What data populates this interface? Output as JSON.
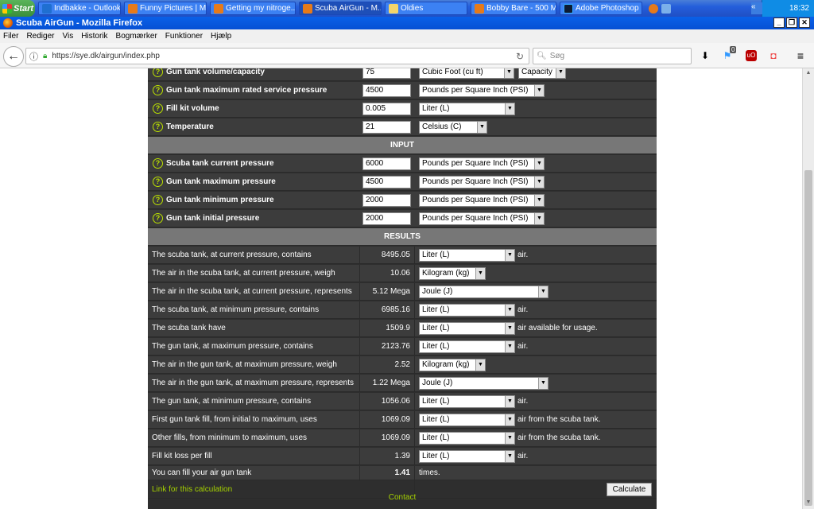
{
  "taskbar": {
    "start_label": "Start",
    "items": [
      {
        "label": "Indbakke - Outlook ..."
      },
      {
        "label": "Funny Pictures | M..."
      },
      {
        "label": "Getting my nitroge..."
      },
      {
        "label": "Scuba AirGun - M..."
      },
      {
        "label": "Oldies"
      },
      {
        "label": "Bobby Bare - 500 M..."
      },
      {
        "label": "Adobe Photoshop"
      }
    ],
    "tray_toggle": "«",
    "clock": "18:32"
  },
  "window": {
    "title": "Scuba AirGun - Mozilla Firefox"
  },
  "menu": [
    "Filer",
    "Rediger",
    "Vis",
    "Historik",
    "Bogmærker",
    "Funktioner",
    "Hjælp"
  ],
  "browser": {
    "url": "https://sye.dk/airgun/index.php",
    "search_placeholder": "Søg",
    "notification_count": "0"
  },
  "settings_rows": [
    {
      "label": "Gun tank volume/capacity",
      "value": "75",
      "unit": "Cubic Foot (cu ft)",
      "unit2": "Capacity"
    },
    {
      "label": "Gun tank maximum rated service pressure",
      "value": "4500",
      "unit": "Pounds per Square Inch (PSI)"
    },
    {
      "label": "Fill kit volume",
      "value": "0.005",
      "unit": "Liter (L)"
    },
    {
      "label": "Temperature",
      "value": "21",
      "unit": "Celsius (C)"
    }
  ],
  "input_header": "INPUT",
  "input_rows": [
    {
      "label": "Scuba tank current pressure",
      "value": "6000",
      "unit": "Pounds per Square Inch (PSI)"
    },
    {
      "label": "Gun tank maximum pressure",
      "value": "4500",
      "unit": "Pounds per Square Inch (PSI)"
    },
    {
      "label": "Gun tank minimum pressure",
      "value": "2000",
      "unit": "Pounds per Square Inch (PSI)"
    },
    {
      "label": "Gun tank initial pressure",
      "value": "2000",
      "unit": "Pounds per Square Inch (PSI)"
    }
  ],
  "results_header": "RESULTS",
  "result_rows": [
    {
      "label": "The scuba tank, at current pressure, contains",
      "value": "8495.05",
      "unit": "Liter (L)",
      "suffix": "air."
    },
    {
      "label": "The air in the scuba tank, at current pressure, weigh",
      "value": "10.06",
      "unit": "Kilogram (kg)",
      "suffix": ""
    },
    {
      "label": "The air in the scuba tank, at current pressure, represents",
      "value": "5.12 Mega",
      "unit": "Joule (J)",
      "suffix": ""
    },
    {
      "label": "The scuba tank, at minimum pressure, contains",
      "value": "6985.16",
      "unit": "Liter (L)",
      "suffix": "air."
    },
    {
      "label": "The scuba tank have",
      "value": "1509.9",
      "unit": "Liter (L)",
      "suffix": "air available for usage."
    },
    {
      "label": "The gun tank, at maximum pressure, contains",
      "value": "2123.76",
      "unit": "Liter (L)",
      "suffix": "air."
    },
    {
      "label": "The air in the gun tank, at maximum pressure, weigh",
      "value": "2.52",
      "unit": "Kilogram (kg)",
      "suffix": ""
    },
    {
      "label": "The air in the gun tank, at maximum pressure, represents",
      "value": "1.22 Mega",
      "unit": "Joule (J)",
      "suffix": ""
    },
    {
      "label": "The gun tank, at minimum pressure, contains",
      "value": "1056.06",
      "unit": "Liter (L)",
      "suffix": "air."
    },
    {
      "label": "First gun tank fill, from initial to maximum, uses",
      "value": "1069.09",
      "unit": "Liter (L)",
      "suffix": "air from the scuba tank."
    },
    {
      "label": "Other fills, from minimum to maximum, uses",
      "value": "1069.09",
      "unit": "Liter (L)",
      "suffix": "air from the scuba tank."
    },
    {
      "label": "Fill kit loss per fill",
      "value": "1.39",
      "unit": "Liter (L)",
      "suffix": "air."
    }
  ],
  "summary": {
    "label": "You can fill your air gun tank",
    "value": "1.41",
    "suffix": "times."
  },
  "footer": {
    "link_label": "Link for this calculation",
    "calculate_label": "Calculate",
    "contact_label": "Contact"
  }
}
